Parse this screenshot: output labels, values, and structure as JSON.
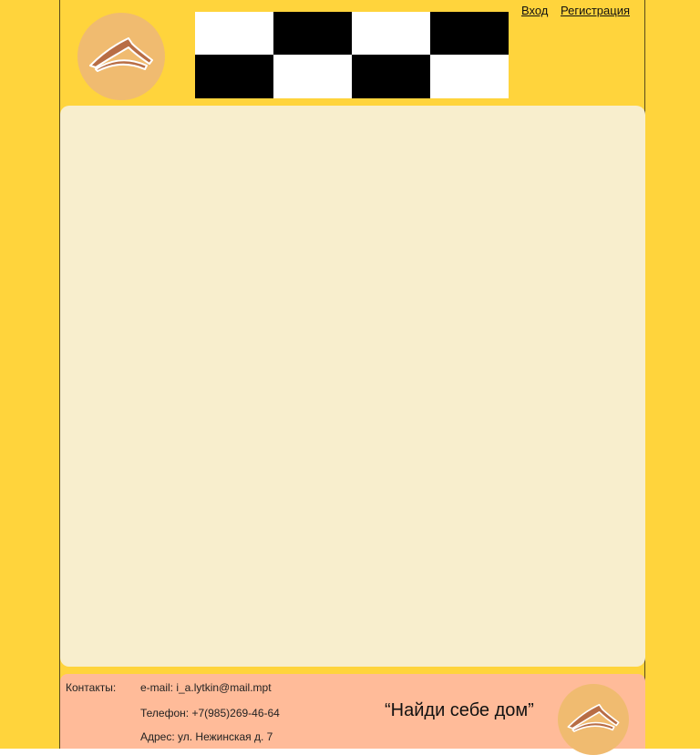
{
  "colors": {
    "page_background": "#FFD43C",
    "main_panel": "#F8EECD",
    "footer_background": "#FFBB99",
    "logo_circle": "#F0BB70",
    "logo_roof": "#B86D45",
    "checker_dark": "#000000",
    "checker_light": "#FFFFFF"
  },
  "header": {
    "logo_icon": "house-roof-logo",
    "banner_pattern": [
      "light",
      "dark",
      "light",
      "dark",
      "dark",
      "light",
      "dark",
      "light"
    ],
    "auth": {
      "login_label": "Вход",
      "register_label": "Регистрация"
    }
  },
  "footer": {
    "contacts_label": "Контакты:",
    "email": "e-mail: i_a.lytkin@mail.mpt",
    "phone": "Телефон: +7(985)269-46-64",
    "address": "Адрес: ул. Нежинская д. 7",
    "slogan": "“Найди себе дом”",
    "logo_icon": "house-roof-logo"
  }
}
